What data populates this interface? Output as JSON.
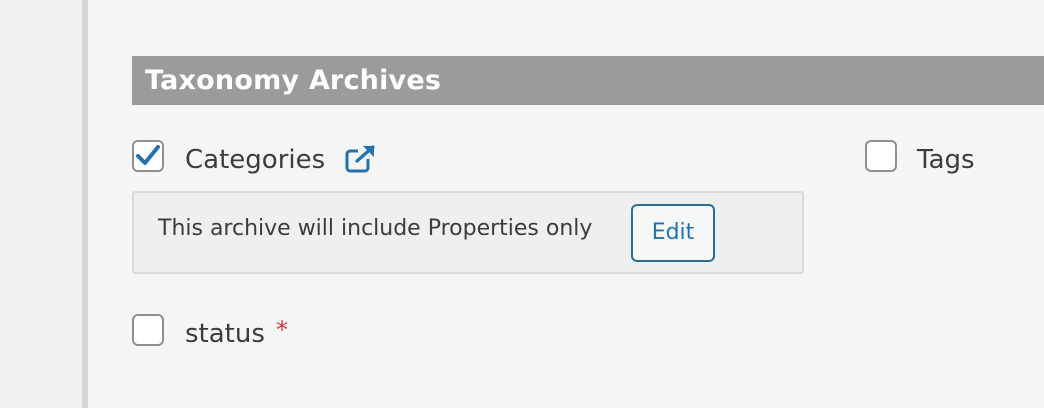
{
  "section": {
    "title": "Taxonomy Archives"
  },
  "taxonomies": {
    "categories": {
      "label": "Categories",
      "checked": true
    },
    "tags": {
      "label": "Tags",
      "checked": false
    },
    "status": {
      "label": "status",
      "checked": false,
      "required_marker": "*"
    }
  },
  "info_box": {
    "text": "This archive will include Properties only",
    "edit_label": "Edit"
  },
  "colors": {
    "accent": "#2271b1",
    "header_bg": "#9b9b9b",
    "required": "#d63638"
  },
  "icons": {
    "external_link": "external-link-icon",
    "checkmark": "checkmark-icon"
  }
}
